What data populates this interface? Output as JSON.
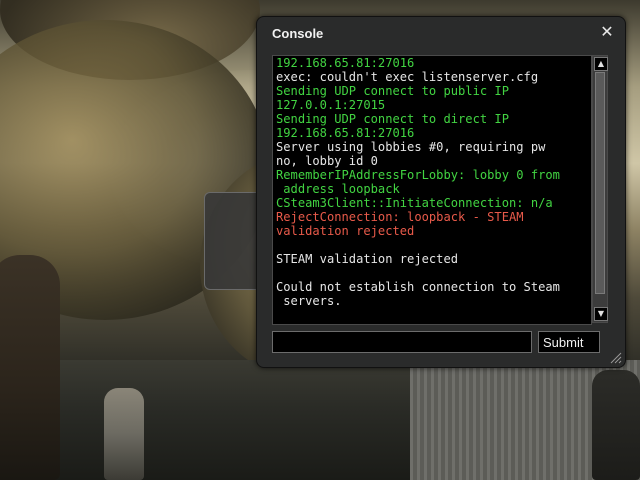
{
  "console": {
    "title": "Console",
    "close_icon": "close-icon",
    "output_lines": [
      {
        "text": "192.168.65.81:27016",
        "color": "green"
      },
      {
        "text": "exec: couldn't exec listenserver.cfg",
        "color": "white"
      },
      {
        "text": "Sending UDP connect to public IP",
        "color": "green"
      },
      {
        "text": "127.0.0.1:27015",
        "color": "green"
      },
      {
        "text": "Sending UDP connect to direct IP",
        "color": "green"
      },
      {
        "text": "192.168.65.81:27016",
        "color": "green"
      },
      {
        "text": "Server using lobbies #0, requiring pw",
        "color": "white"
      },
      {
        "text": "no, lobby id 0",
        "color": "white"
      },
      {
        "text": "RememberIPAddressForLobby: lobby 0 from",
        "color": "green"
      },
      {
        "text": " address loopback",
        "color": "green"
      },
      {
        "text": "CSteam3Client::InitiateConnection: n/a",
        "color": "green"
      },
      {
        "text": "RejectConnection: loopback - STEAM",
        "color": "red"
      },
      {
        "text": "validation rejected",
        "color": "red"
      },
      {
        "text": "",
        "color": "white"
      },
      {
        "text": "STEAM validation rejected",
        "color": "white"
      },
      {
        "text": "",
        "color": "white"
      },
      {
        "text": "Could not establish connection to Steam",
        "color": "white"
      },
      {
        "text": " servers.",
        "color": "white"
      }
    ],
    "command_value": "",
    "submit_label": "Submit"
  },
  "colors": {
    "green_text": "#42d442",
    "white_text": "#e6e6e6",
    "red_text": "#e85a4a",
    "panel_bg": "#2a2b2b",
    "output_bg": "#000000"
  }
}
